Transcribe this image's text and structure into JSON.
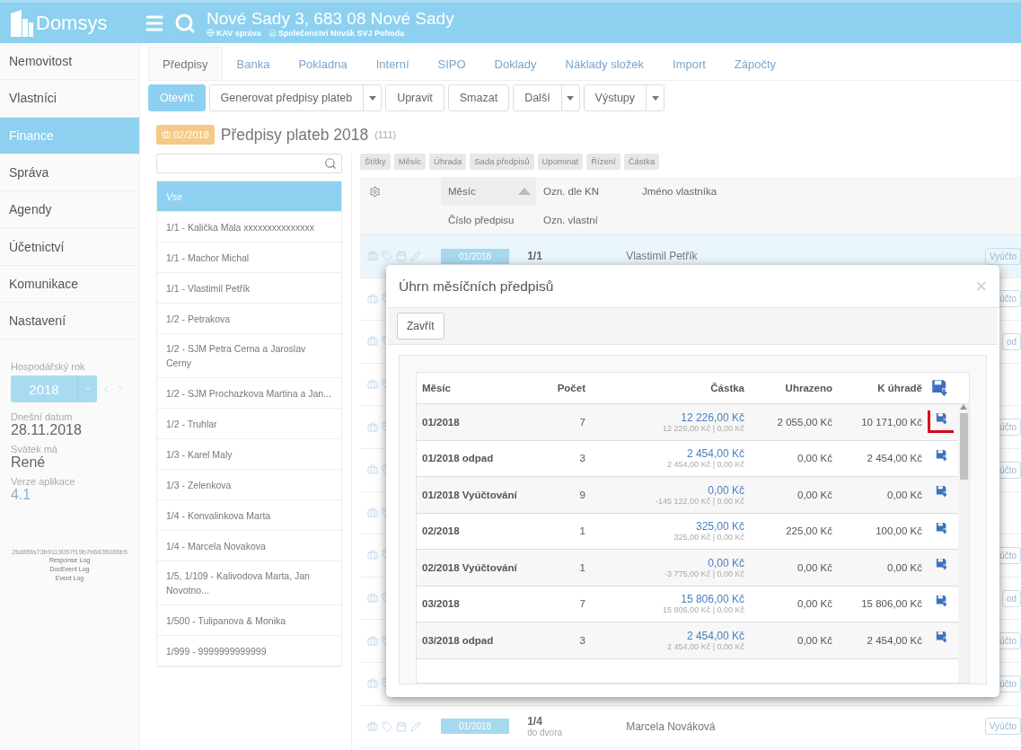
{
  "header": {
    "logo": "Domsys",
    "title": "Nové Sady 3, 683 08 Nové Sady",
    "links": [
      "KAV správa",
      "Společenství Novák SVJ Pohoda"
    ]
  },
  "sidebar": {
    "items": [
      {
        "label": "Nemovitost",
        "selected": false
      },
      {
        "label": "Vlastníci",
        "selected": false
      },
      {
        "label": "Finance",
        "selected": true
      },
      {
        "label": "Správa",
        "selected": false
      },
      {
        "label": "Agendy",
        "selected": false
      },
      {
        "label": "Účetnictví",
        "selected": false
      },
      {
        "label": "Komunikace",
        "selected": false
      },
      {
        "label": "Nastavení",
        "selected": false
      }
    ],
    "info": [
      {
        "label": "Hospodářský rok",
        "kind": "year",
        "value": "2018"
      },
      {
        "label": "Dnešní datum",
        "kind": "text",
        "value": "28.11.2018"
      },
      {
        "label": "Svátek má",
        "kind": "text",
        "value": "René"
      },
      {
        "label": "Verze aplikace",
        "kind": "version",
        "value": "4.1"
      }
    ],
    "hash": "26d85fa73b9119057f19b7b6835065b5",
    "logs": [
      "Response Log",
      "DocEvent Log",
      "Event Log"
    ]
  },
  "tabs": [
    {
      "label": "Předpisy",
      "selected": true
    },
    {
      "label": "Banka",
      "selected": false
    },
    {
      "label": "Pokladna",
      "selected": false
    },
    {
      "label": "Interní",
      "selected": false
    },
    {
      "label": "SIPO",
      "selected": false
    },
    {
      "label": "Doklady",
      "selected": false
    },
    {
      "label": "Náklady složek",
      "selected": false
    },
    {
      "label": "Import",
      "selected": false
    },
    {
      "label": "Zápočty",
      "selected": false
    }
  ],
  "toolbar": [
    {
      "label": "Otevřít",
      "primary": true,
      "dropdown": false
    },
    {
      "label": "Generovat předpisy plateb",
      "primary": false,
      "dropdown": true
    },
    {
      "label": "Upravit",
      "primary": false,
      "dropdown": false
    },
    {
      "label": "Smazat",
      "primary": false,
      "dropdown": false
    },
    {
      "label": "Další",
      "primary": false,
      "dropdown": true
    },
    {
      "label": "Výstupy",
      "primary": false,
      "dropdown": true
    }
  ],
  "heading": {
    "badge": "02/2018",
    "title": "Předpisy plateb 2018",
    "count": "(111)"
  },
  "owners": [
    {
      "label": "Vse",
      "selected": true
    },
    {
      "label": "1/1 - Kalička Mala xxxxxxxxxxxxxxx",
      "selected": false
    },
    {
      "label": "1/1 - Machor Michal",
      "selected": false
    },
    {
      "label": "1/1 - Vlastimil Petřík",
      "selected": false
    },
    {
      "label": "1/2 - Petrakova",
      "selected": false
    },
    {
      "label": "1/2 - SJM Petra Cerna a Jaroslav Cerny",
      "selected": false
    },
    {
      "label": "1/2 - SJM Prochazkova Martina a Jan...",
      "selected": false
    },
    {
      "label": "1/2 - Truhlar",
      "selected": false
    },
    {
      "label": "1/3 - Karel Maly",
      "selected": false
    },
    {
      "label": "1/3 - Zelenkova",
      "selected": false
    },
    {
      "label": "1/4 - Konvalinkova Marta",
      "selected": false
    },
    {
      "label": "1/4 - Marcela Novakova",
      "selected": false
    },
    {
      "label": "1/5, 1/109 - Kalivodova Marta, Jan Novotno...",
      "selected": false
    },
    {
      "label": "1/500 - Tulipanova & Monika",
      "selected": false
    },
    {
      "label": "1/999 - 9999999999999",
      "selected": false
    }
  ],
  "filters": [
    "Štítky",
    "Měsíc",
    "Úhrada",
    "Sada předpisů",
    "Upominat",
    "Řízení",
    "Částka"
  ],
  "table": {
    "columns": [
      "Měsíc",
      "Ozn. dle KN",
      "Jméno vlastníka"
    ],
    "subcolumns": [
      "Číslo předpisu",
      "Ozn. vlastní"
    ],
    "rows": [
      {
        "month": "01/2018",
        "unit": "1/1",
        "note": "",
        "owner": "Vlastimil Petřík",
        "action": "Vyúčto",
        "selected": true
      },
      {
        "action": "účto",
        "selected": false
      },
      {
        "action": "od",
        "selected": false
      },
      {
        "action": "",
        "selected": false
      },
      {
        "action": "účto",
        "selected": false
      },
      {
        "action": "účto",
        "selected": false
      },
      {
        "action": "",
        "selected": false
      },
      {
        "action": "účto",
        "selected": false
      },
      {
        "action": "od",
        "selected": false
      },
      {
        "action": "účto",
        "selected": false
      },
      {
        "action": "účto",
        "selected": false
      },
      {
        "month": "01/2018",
        "unit": "1/4",
        "note": "do dvora",
        "owner": "Marcela Nováková",
        "action": "Vyúčto",
        "selected": false
      }
    ]
  },
  "modal": {
    "title": "Úhrn měsíčních předpisů",
    "close": "×",
    "button": "Zavřít",
    "columns": [
      "Měsíc",
      "Počet",
      "Částka",
      "Uhrazeno",
      "K úhradě"
    ],
    "rows": [
      {
        "month": "01/2018",
        "count": "7",
        "amount": "12 226,00 Kč",
        "detail": "12 226,00 Kč | 0,00 Kč",
        "paid": "2 055,00 Kč",
        "due": "10 171,00 Kč",
        "highlighted": true
      },
      {
        "month": "01/2018 odpad",
        "count": "3",
        "amount": "2 454,00 Kč",
        "detail": "2 454,00 Kč | 0,00 Kč",
        "paid": "0,00 Kč",
        "due": "2 454,00 Kč",
        "highlighted": false
      },
      {
        "month": "01/2018 Vyúčtování",
        "count": "9",
        "amount": "0,00 Kč",
        "detail": "-145 122,00 Kč | 0,00 Kč",
        "paid": "0,00 Kč",
        "due": "0,00 Kč",
        "highlighted": false
      },
      {
        "month": "02/2018",
        "count": "1",
        "amount": "325,00 Kč",
        "detail": "325,00 Kč | 0,00 Kč",
        "paid": "225,00 Kč",
        "due": "100,00 Kč",
        "highlighted": false
      },
      {
        "month": "02/2018 Vyúčtování",
        "count": "1",
        "amount": "0,00 Kč",
        "detail": "-3 775,00 Kč | 0,00 Kč",
        "paid": "0,00 Kč",
        "due": "0,00 Kč",
        "highlighted": false
      },
      {
        "month": "03/2018",
        "count": "7",
        "amount": "15 806,00 Kč",
        "detail": "15 806,00 Kč | 0,00 Kč",
        "paid": "0,00 Kč",
        "due": "15 806,00 Kč",
        "highlighted": false
      },
      {
        "month": "03/2018 odpad",
        "count": "3",
        "amount": "2 454,00 Kč",
        "detail": "2 454,00 Kč | 0,00 Kč",
        "paid": "0,00 Kč",
        "due": "2 454,00 Kč",
        "highlighted": false
      }
    ]
  }
}
